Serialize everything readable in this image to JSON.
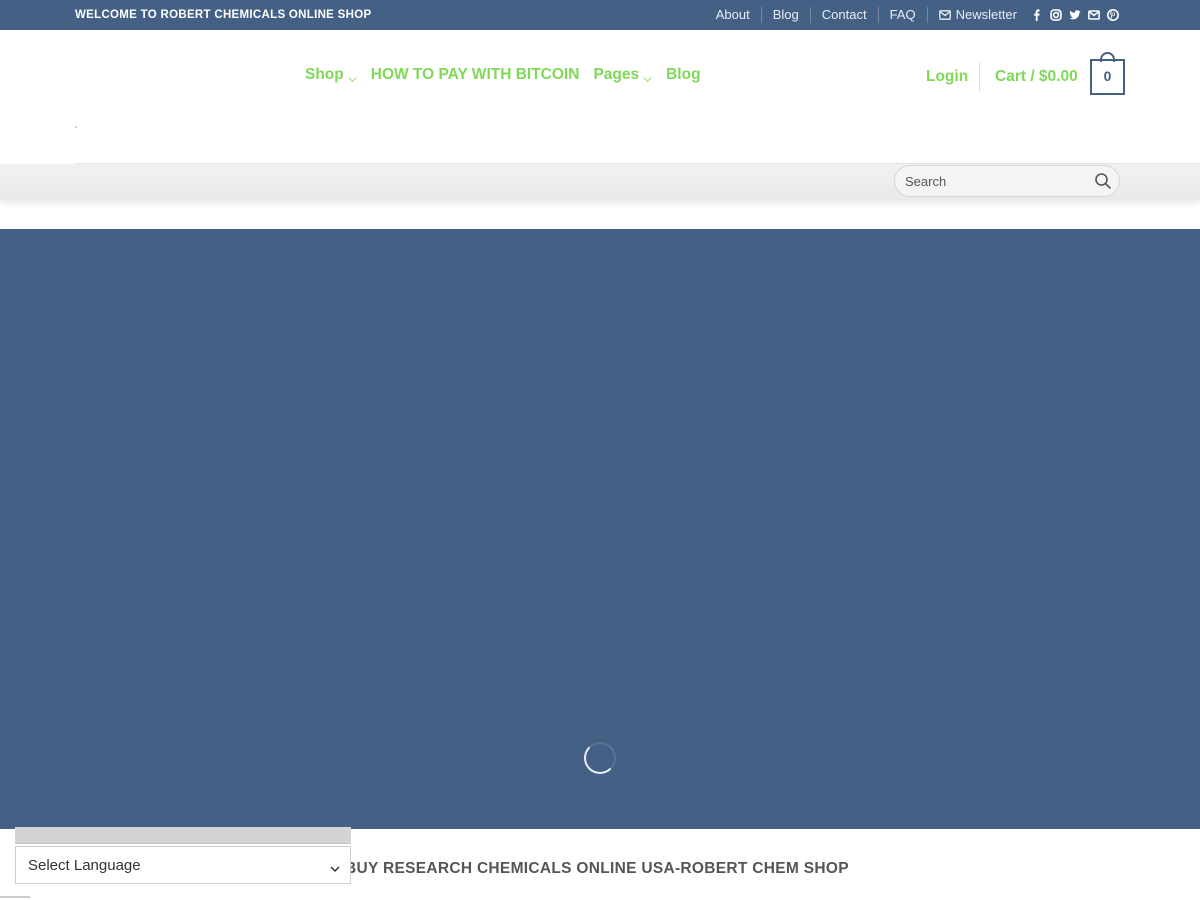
{
  "topbar": {
    "welcome": "WELCOME TO ROBERT CHEMICALS ONLINE SHOP",
    "links": [
      "About",
      "Blog",
      "Contact",
      "FAQ"
    ],
    "newsletter": "Newsletter",
    "social_icons": [
      "facebook-icon",
      "instagram-icon",
      "twitter-icon",
      "email-icon",
      "pinterest-icon"
    ]
  },
  "nav": {
    "items": [
      {
        "label": "Shop",
        "has_dropdown": true
      },
      {
        "label": "HOW TO PAY WITH BITCOIN",
        "has_dropdown": false
      },
      {
        "label": "Pages",
        "has_dropdown": true
      },
      {
        "label": "Blog",
        "has_dropdown": false
      }
    ],
    "login": "Login",
    "cart_label": "Cart / $0.00",
    "cart_count": "0"
  },
  "search": {
    "placeholder": "Search"
  },
  "main": {
    "heading": "BUY RESEARCH CHEMICALS ONLINE USA-ROBERT CHEM SHOP"
  },
  "language": {
    "selected": "Select Language"
  },
  "colors": {
    "primary": "#446084",
    "accent": "#7ed957",
    "text": "#555555"
  }
}
